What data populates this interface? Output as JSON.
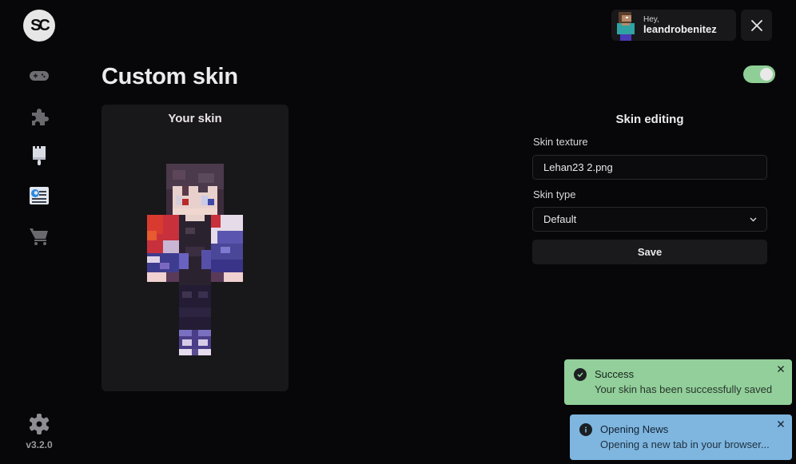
{
  "app": {
    "logo_text": "SC",
    "version": "v3.2.0"
  },
  "sidebar": {
    "items": [
      {
        "name": "games",
        "icon": "gamepad-icon",
        "active": false
      },
      {
        "name": "mods",
        "icon": "puzzle-icon",
        "active": false
      },
      {
        "name": "skins",
        "icon": "paintbrush-icon",
        "active": false
      },
      {
        "name": "news",
        "icon": "news-icon",
        "active": true
      },
      {
        "name": "store",
        "icon": "cart-icon",
        "active": false
      }
    ],
    "settings_icon": "gear-icon"
  },
  "header": {
    "greeting": "Hey,",
    "username": "leandrobenitez",
    "close_icon": "close-icon",
    "toggle_on": true
  },
  "main": {
    "title": "Custom skin",
    "skin_card": {
      "title": "Your skin"
    },
    "editing": {
      "title": "Skin editing",
      "texture_label": "Skin texture",
      "texture_value": "Lehan23 2.png",
      "type_label": "Skin type",
      "type_value": "Default",
      "save_label": "Save"
    }
  },
  "toasts": [
    {
      "kind": "success",
      "title": "Success",
      "message": "Your skin has been successfully saved",
      "color": "#92cf9a"
    },
    {
      "kind": "info",
      "title": "Opening News",
      "message": "Opening a new tab in your browser...",
      "color": "#7eb6df"
    }
  ]
}
